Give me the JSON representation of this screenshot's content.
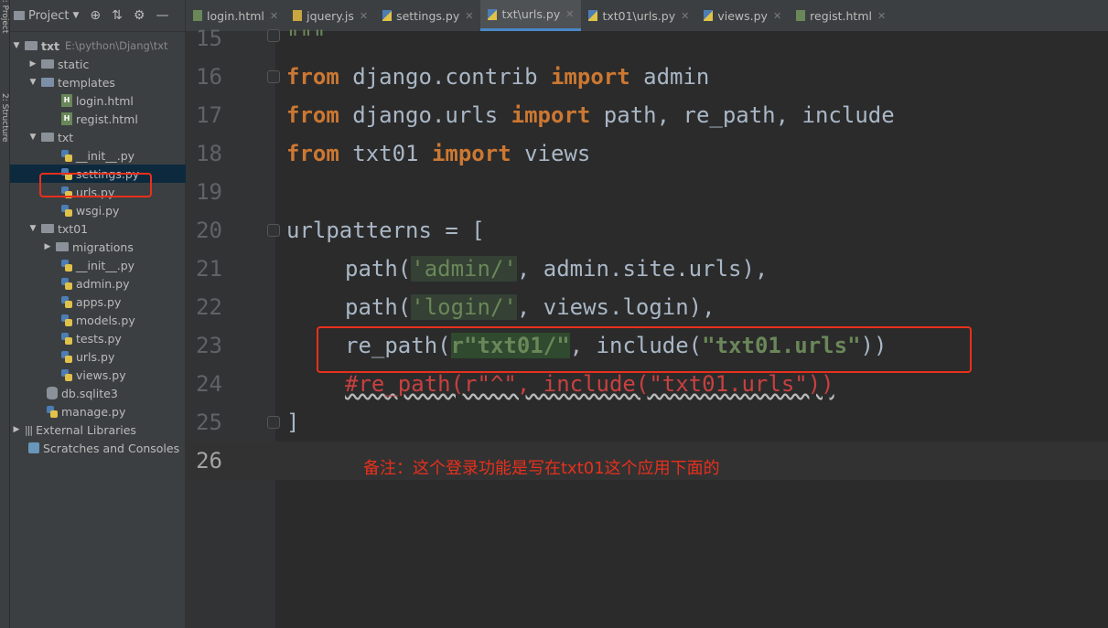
{
  "side_strip": {
    "project_label": "1: Project",
    "structure_label": "2: Structure"
  },
  "project_panel": {
    "title": "Project",
    "tree": [
      {
        "label": "txt",
        "path": "E:\\python\\Djang\\txt",
        "level": 0,
        "kind": "folder",
        "expanded": true
      },
      {
        "label": "static",
        "level": 1,
        "kind": "folder",
        "expanded": false
      },
      {
        "label": "templates",
        "level": 1,
        "kind": "folder-blue",
        "expanded": true
      },
      {
        "label": "login.html",
        "level": 2,
        "kind": "html"
      },
      {
        "label": "regist.html",
        "level": 2,
        "kind": "html"
      },
      {
        "label": "txt",
        "level": 1,
        "kind": "folder",
        "expanded": true
      },
      {
        "label": "__init__.py",
        "level": 2,
        "kind": "py"
      },
      {
        "label": "settings.py",
        "level": 2,
        "kind": "py",
        "selected": true
      },
      {
        "label": "urls.py",
        "level": 2,
        "kind": "py"
      },
      {
        "label": "wsgi.py",
        "level": 2,
        "kind": "py"
      },
      {
        "label": "txt01",
        "level": 1,
        "kind": "folder",
        "expanded": true
      },
      {
        "label": "migrations",
        "level": 2,
        "kind": "folder",
        "expanded": false
      },
      {
        "label": "__init__.py",
        "level": 2,
        "kind": "py"
      },
      {
        "label": "admin.py",
        "level": 2,
        "kind": "py"
      },
      {
        "label": "apps.py",
        "level": 2,
        "kind": "py"
      },
      {
        "label": "models.py",
        "level": 2,
        "kind": "py"
      },
      {
        "label": "tests.py",
        "level": 2,
        "kind": "py"
      },
      {
        "label": "urls.py",
        "level": 2,
        "kind": "py"
      },
      {
        "label": "views.py",
        "level": 2,
        "kind": "py"
      },
      {
        "label": "db.sqlite3",
        "level": 1,
        "kind": "db"
      },
      {
        "label": "manage.py",
        "level": 1,
        "kind": "py"
      },
      {
        "label": "External Libraries",
        "level": 0,
        "kind": "lib",
        "expanded": false
      },
      {
        "label": "Scratches and Consoles",
        "level": 0,
        "kind": "scratch"
      }
    ]
  },
  "tabs": [
    {
      "label": "login.html",
      "kind": "html"
    },
    {
      "label": "jquery.js",
      "kind": "js"
    },
    {
      "label": "settings.py",
      "kind": "py"
    },
    {
      "label": "txt\\urls.py",
      "kind": "py",
      "active": true
    },
    {
      "label": "txt01\\urls.py",
      "kind": "py"
    },
    {
      "label": "views.py",
      "kind": "py"
    },
    {
      "label": "regist.html",
      "kind": "html"
    }
  ],
  "editor": {
    "line_numbers": [
      "15",
      "16",
      "17",
      "18",
      "19",
      "20",
      "21",
      "22",
      "23",
      "24",
      "25",
      "26"
    ],
    "current_line": "26",
    "lines": {
      "l15": "\"\"\"",
      "l16": {
        "kw1": "from",
        "mod": " django.contrib ",
        "kw2": "import",
        "name": " admin"
      },
      "l17": {
        "kw1": "from",
        "mod": " django.urls ",
        "kw2": "import",
        "name": " path, re_path, include"
      },
      "l18": {
        "kw1": "from",
        "mod": " txt01 ",
        "kw2": "import",
        "name": " views"
      },
      "l20": "urlpatterns = [",
      "l21": {
        "a": "path(",
        "s": "'admin/'",
        "b": ", admin.site.urls),"
      },
      "l22": {
        "a": "path(",
        "s": "'login/'",
        "b": ", views.login),"
      },
      "l23": {
        "a": "re_path(",
        "s1": "r\"txt01/\"",
        "b": ", include(",
        "s2": "\"txt01.urls\"",
        "c": "))"
      },
      "l24": "#re_path(r\"^\", include(\"txt01.urls\"))",
      "l25": "]"
    },
    "note": "备注：这个登录功能是写在txt01这个应用下面的"
  }
}
